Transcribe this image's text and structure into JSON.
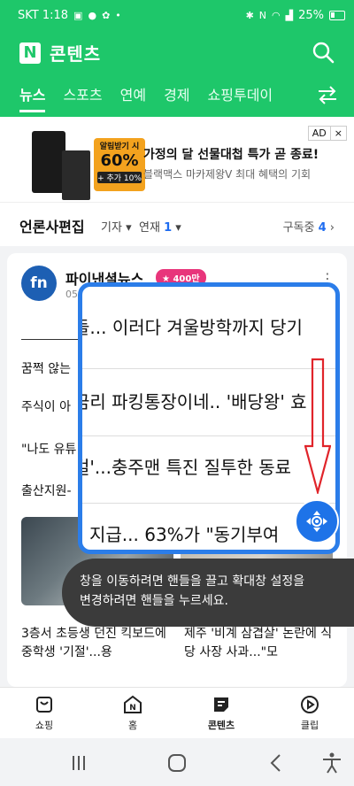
{
  "status_bar": {
    "carrier_time": "SKT 1:18",
    "battery": "25%"
  },
  "header": {
    "brand_logo": "N",
    "brand_title": "콘텐츠",
    "tabs": [
      {
        "label": "뉴스",
        "active": true
      },
      {
        "label": "스포츠"
      },
      {
        "label": "연예"
      },
      {
        "label": "경제"
      },
      {
        "label": "쇼핑투데이"
      }
    ]
  },
  "ad": {
    "badge": "AD",
    "close": "×",
    "promo_big": "60%",
    "promo_top": "알림받기 시",
    "promo_bottom": "+ 추가 10%",
    "title": "가정의 달 선물대첩 특가 곧 종료!",
    "subtitle": "블랙맥스 마카제왕V 최대 혜택의 기회"
  },
  "section": {
    "title": "언론사편집",
    "filter_reporter": "기자",
    "filter_series": "연재",
    "filter_series_count": "1",
    "subscribed_label": "구독중",
    "subscribed_count": "4"
  },
  "article": {
    "source_logo": "fn",
    "source_name": "파이낸셜뉴스",
    "source_badge": "400만",
    "source_date": "05",
    "list": [
      "꿈쩍 않는",
      "주식이 아",
      "\"나도 유튜",
      "출산지원-"
    ],
    "captions": [
      "3층서 초등생 던진 킥보드에 중학생 '기절'...용",
      "제주 '비계 삼겹살' 논란에 식당 사장 사과...\"모"
    ]
  },
  "magnifier": {
    "lines": [
      "들... 이러다 겨울방학까지 당기",
      "금리 파킹통장이네.. '배당왕' 효",
      "걸'...충주맨 특진 질투한 동료",
      "지급... 63%가 \"동기부여"
    ]
  },
  "tooltip": {
    "text_line1": "창을 이동하려면 핸들을 끌고 확대창 설정을",
    "text_line2": "변경하려면 핸들을 누르세요."
  },
  "bottom_nav": [
    {
      "label": "쇼핑",
      "icon": "shopping-bag-icon"
    },
    {
      "label": "홈",
      "icon": "home-n-icon"
    },
    {
      "label": "콘텐츠",
      "icon": "content-icon",
      "active": true
    },
    {
      "label": "클립",
      "icon": "clip-play-icon"
    }
  ],
  "colors": {
    "brand": "#1ec76a",
    "accent_blue": "#2b7de9",
    "badge_pink": "#e8357b",
    "arrow_red": "#e0242a"
  }
}
